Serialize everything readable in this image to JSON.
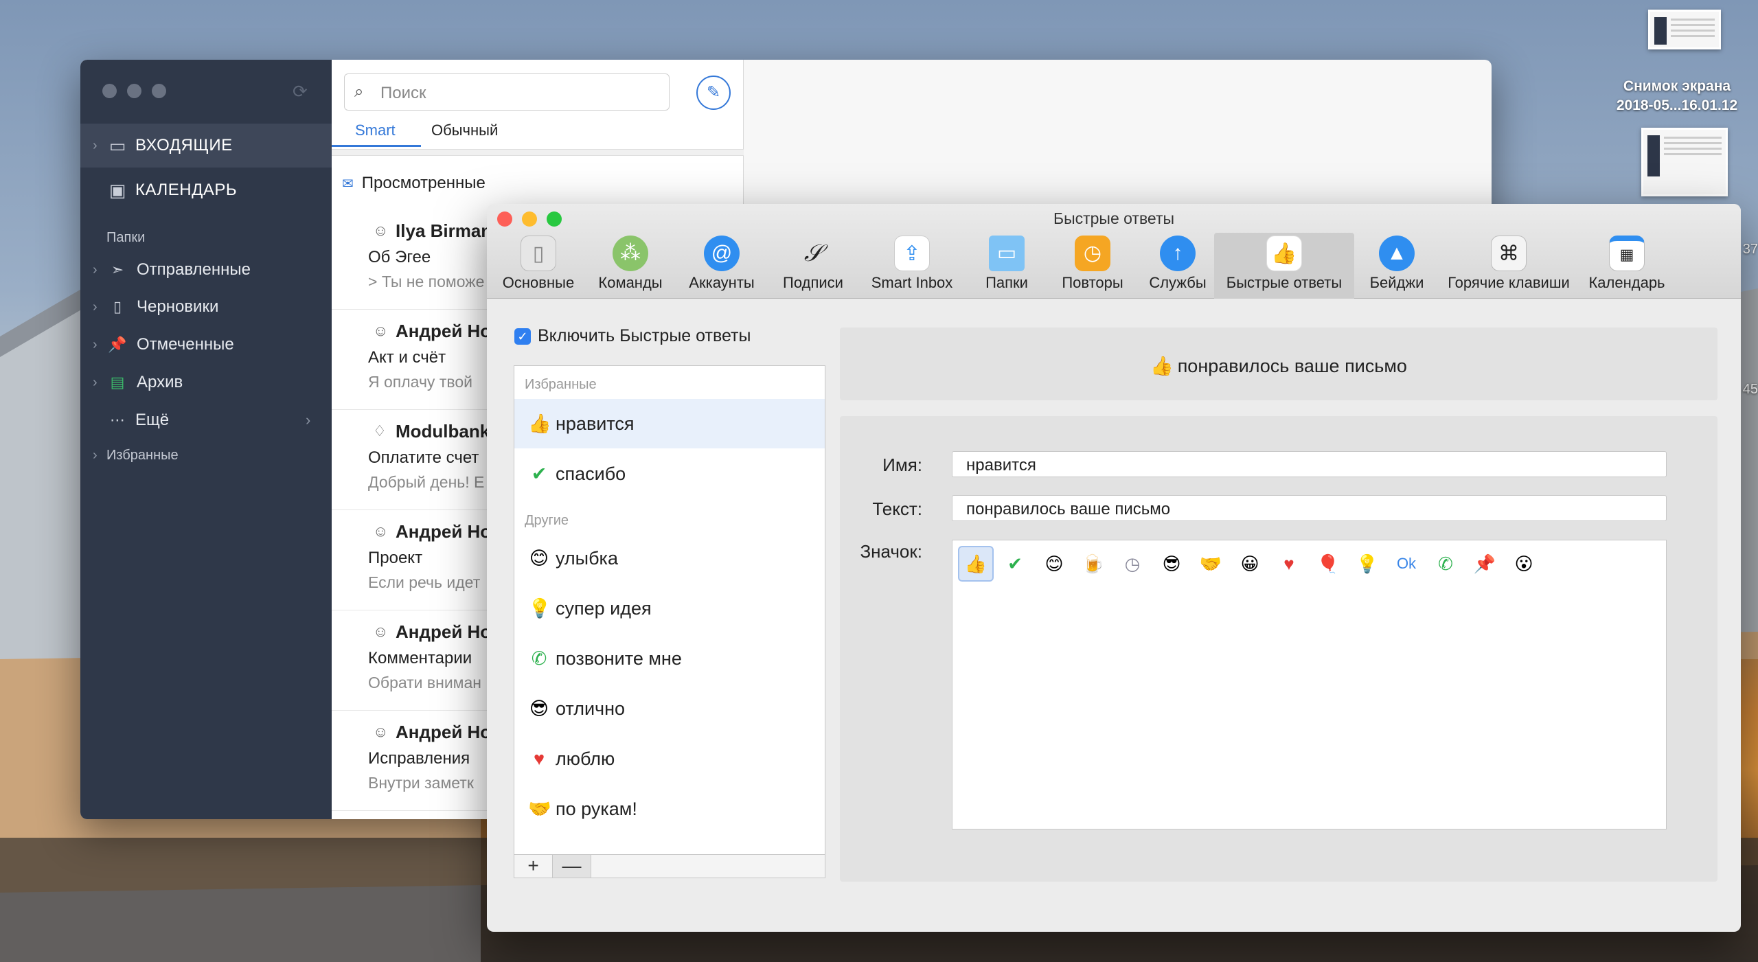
{
  "desktop": {
    "screenshot_label_line1": "Снимок экрана",
    "screenshot_label_line2": "2018-05...16.01.12",
    "edge_text_1": "37",
    "edge_text_2": "45"
  },
  "mail": {
    "sidebar": {
      "inbox": "ВХОДЯЩИЕ",
      "calendar": "КАЛЕНДАРЬ",
      "folders_header": "Папки",
      "folders": [
        {
          "label": "Отправленные",
          "icon": "paper-plane-icon"
        },
        {
          "label": "Черновики",
          "icon": "draft-document-icon"
        },
        {
          "label": "Отмеченные",
          "icon": "pin-icon"
        },
        {
          "label": "Архив",
          "icon": "archive-box-icon"
        }
      ],
      "more": "Ещё",
      "favorites": "Избранные"
    },
    "search_placeholder": "Поиск",
    "tabs": {
      "smart": "Smart",
      "usual": "Обычный"
    },
    "viewed_header": "Просмотренные",
    "messages": [
      {
        "sender": "Ilya Birman",
        "subject": "Об Эгее",
        "preview": "> Ты не поможе"
      },
      {
        "sender": "Андрей Ho",
        "subject": "Акт и счёт",
        "preview": "Я оплачу твой"
      },
      {
        "sender": "Modulbank",
        "subject": "Оплатите счет",
        "preview": "Добрый день! E"
      },
      {
        "sender": "Андрей Ho",
        "subject": "Проект",
        "preview": "Если речь идет"
      },
      {
        "sender": "Андрей Ho",
        "subject": "Комментарии",
        "preview": "Обрати вниман"
      },
      {
        "sender": "Андрей Ho",
        "subject": "Исправления",
        "preview": "Внутри заметк"
      }
    ]
  },
  "prefs": {
    "title": "Быстрые ответы",
    "toolbar": [
      {
        "label": "Основные",
        "icon": "phone-general-icon"
      },
      {
        "label": "Команды",
        "icon": "team-icon"
      },
      {
        "label": "Аккаунты",
        "icon": "at-sign-icon"
      },
      {
        "label": "Подписи",
        "icon": "signature-icon"
      },
      {
        "label": "Smart Inbox",
        "icon": "smart-inbox-icon"
      },
      {
        "label": "Папки",
        "icon": "folder-icon"
      },
      {
        "label": "Повторы",
        "icon": "clock-icon"
      },
      {
        "label": "Службы",
        "icon": "upload-arrow-icon"
      },
      {
        "label": "Быстрые ответы",
        "icon": "thumbs-up-icon"
      },
      {
        "label": "Бейджи",
        "icon": "badge-icon"
      },
      {
        "label": "Горячие клавиши",
        "icon": "command-key-icon"
      },
      {
        "label": "Календарь",
        "icon": "calendar-icon"
      }
    ],
    "enable_label": "Включить Быстрые ответы",
    "favorites_header": "Избранные",
    "others_header": "Другие",
    "favorites": [
      {
        "label": "нравится",
        "icon": "thumbs-up-icon"
      },
      {
        "label": "спасибо",
        "icon": "check-circle-icon"
      }
    ],
    "others": [
      {
        "label": "улыбка",
        "icon": "smile-icon"
      },
      {
        "label": "супер идея",
        "icon": "lightbulb-icon"
      },
      {
        "label": "позвоните мне",
        "icon": "phone-icon"
      },
      {
        "label": "отлично",
        "icon": "sunglasses-icon"
      },
      {
        "label": "люблю",
        "icon": "heart-icon"
      },
      {
        "label": "по рукам!",
        "icon": "handshake-icon"
      }
    ],
    "add_button": "+",
    "remove_button": "—",
    "preview_text": "понравилось ваше письмо",
    "name_label": "Имя:",
    "name_value": "нравится",
    "text_label": "Текст:",
    "text_value": "понравилось ваше письмо",
    "icon_label": "Значок:",
    "icon_choices": [
      "thumbs-up-icon",
      "check-circle-icon",
      "smile-icon",
      "beer-icon",
      "clock-icon",
      "sunglasses-icon",
      "handshake-icon",
      "grin-icon",
      "heart-icon",
      "balloons-icon",
      "lightbulb-icon",
      "ok-icon",
      "phone-icon",
      "pin-icon",
      "surprised-icon"
    ],
    "ok_glyph": "Ok"
  }
}
